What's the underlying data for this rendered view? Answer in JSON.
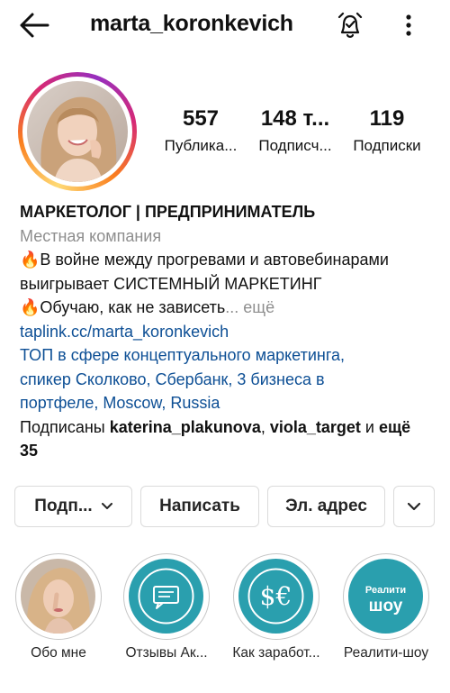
{
  "header": {
    "username": "marta_koronkevich",
    "icons": [
      "back-arrow-icon",
      "notification-bell-icon",
      "more-vertical-icon"
    ]
  },
  "stats": [
    {
      "value": "557",
      "label": "Публика..."
    },
    {
      "value": "148 т...",
      "label": "Подписч..."
    },
    {
      "value": "119",
      "label": "Подписки"
    }
  ],
  "bio": {
    "name": "МАРКЕТОЛОГ | ПРЕДПРИНИМАТЕЛЬ",
    "category": "Местная компания",
    "line1": "🔥В войне между прогревами и автовебинарами",
    "line2": "выигрывает СИСТЕМНЫЙ МАРКЕТИНГ",
    "line3": "🔥Обучаю, как не зависеть",
    "more": "... ещё",
    "link": "taplink.cc/marta_koronkevich",
    "address_line1": "ТОП в сфере концептуального маркетинга,",
    "address_line2": "спикер Сколково, Сбербанк, 3 бизнеса в",
    "address_line3": "портфеле, Moscow, Russia",
    "followed_prefix": "Подписаны ",
    "followed_user1": "katerina_plakunova",
    "followed_sep": ", ",
    "followed_user2": "viola_target",
    "followed_and": " и ",
    "followed_more1": "ещё",
    "followed_more2": "35"
  },
  "buttons": {
    "follow": "Подп...",
    "message": "Написать",
    "email": "Эл. адрес"
  },
  "highlights": [
    {
      "label": "Обо мне"
    },
    {
      "label": "Отзывы Ак..."
    },
    {
      "label": "Как заработ..."
    },
    {
      "label": "Реалити-шоу",
      "cover_text_top": "Реалити",
      "cover_text_bottom": "шоу"
    }
  ],
  "colors": {
    "link": "#0d4f95",
    "muted": "#8e8e8e",
    "teal": "#2a9fae"
  }
}
